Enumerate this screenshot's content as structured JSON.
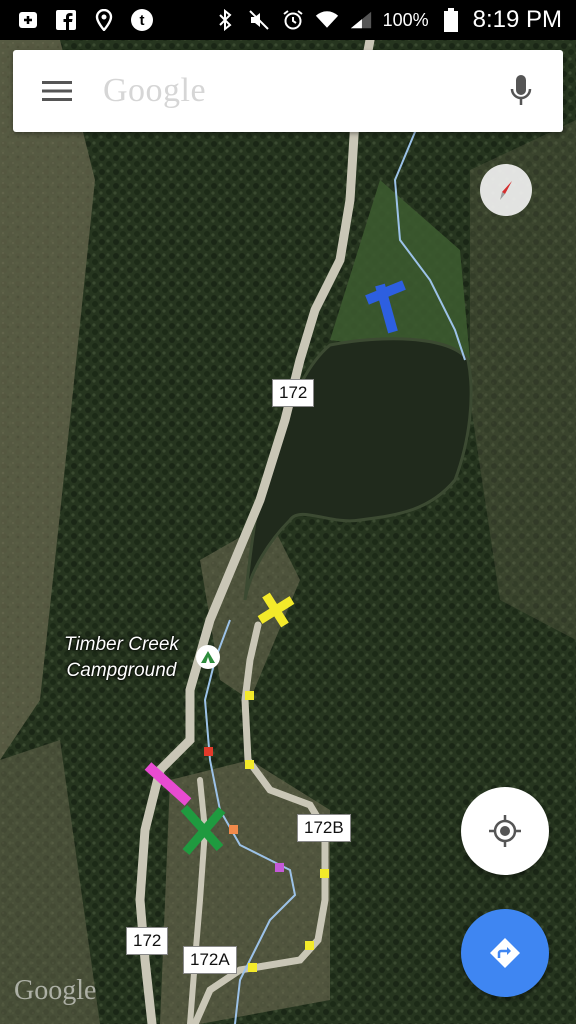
{
  "status_bar": {
    "battery": "100%",
    "time": "8:19 PM"
  },
  "search": {
    "placeholder": "Google"
  },
  "map": {
    "labels": {
      "campground_line1": "Timber Creek",
      "campground_line2": "Campground"
    },
    "road_shields": {
      "r172_top": "172",
      "r172b": "172B",
      "r172_bottom": "172",
      "r172a": "172A"
    },
    "watermark": "Google"
  }
}
